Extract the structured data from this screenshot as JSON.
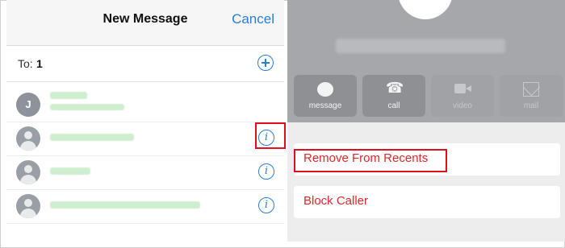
{
  "left": {
    "title": "New Message",
    "cancel": "Cancel",
    "to_label": "To:",
    "to_value": "1",
    "contacts": [
      {
        "initial": "J",
        "avatar": "letter"
      },
      {
        "avatar": "silhouette"
      },
      {
        "avatar": "silhouette"
      },
      {
        "avatar": "silhouette"
      }
    ]
  },
  "right": {
    "actions": [
      {
        "label": "message",
        "icon": "message-bubble-icon"
      },
      {
        "label": "call",
        "icon": "phone-icon"
      },
      {
        "label": "video",
        "icon": "video-camera-icon"
      },
      {
        "label": "mail",
        "icon": "mail-envelope-icon"
      }
    ],
    "remove_from_recents": "Remove From Recents",
    "block_caller": "Block Caller"
  },
  "colors": {
    "accent_blue": "#2a7fd0",
    "danger_red": "#e0282a",
    "highlight_red": "#e01020"
  }
}
